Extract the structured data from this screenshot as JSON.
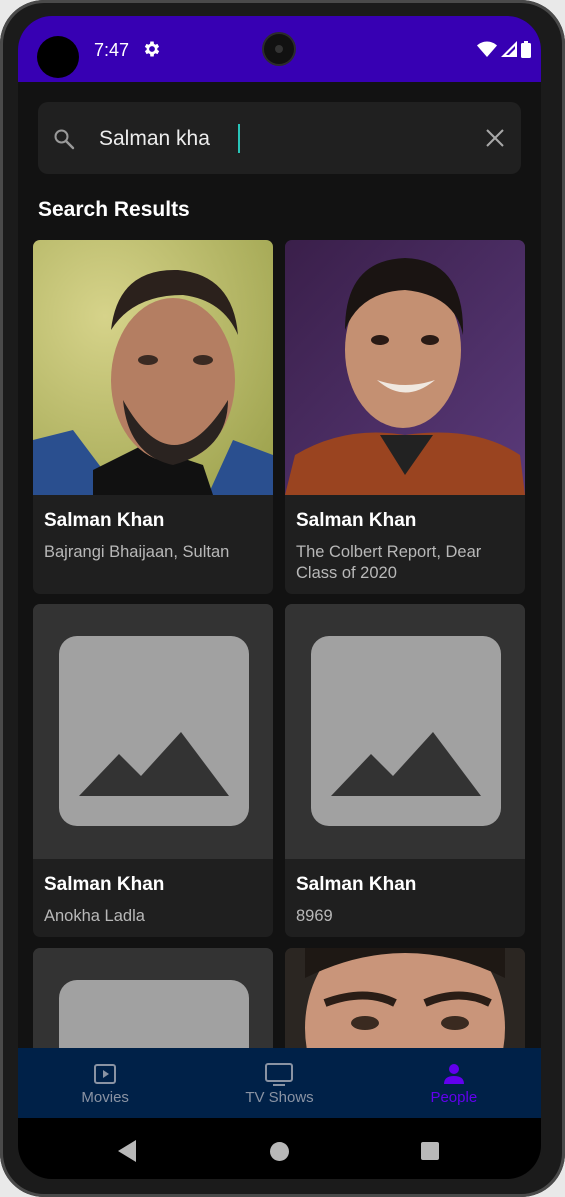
{
  "status_bar": {
    "time": "7:47",
    "background_color": "#3700b3",
    "icons": [
      "gear-icon",
      "wifi-icon",
      "signal-icon",
      "battery-icon"
    ]
  },
  "search": {
    "value": "Salman kha",
    "clear_icon": "close-icon",
    "search_icon": "search-icon"
  },
  "section_title": "Search Results",
  "results": [
    {
      "name": "Salman Khan",
      "known_for": "Bajrangi Bhaijaan, Sultan",
      "image": "photo"
    },
    {
      "name": "Salman Khan",
      "known_for": "The Colbert Report, Dear Class of 2020",
      "image": "photo"
    },
    {
      "name": "Salman Khan",
      "known_for": "Anokha Ladla",
      "image": "placeholder"
    },
    {
      "name": "Salman Khan",
      "known_for": "8969",
      "image": "placeholder"
    },
    {
      "name": "",
      "known_for": "",
      "image": "placeholder"
    },
    {
      "name": "",
      "known_for": "",
      "image": "photo"
    }
  ],
  "bottom_nav": {
    "items": [
      {
        "label": "Movies",
        "icon": "movie-icon"
      },
      {
        "label": "TV Shows",
        "icon": "tv-icon"
      },
      {
        "label": "People",
        "icon": "person-icon"
      }
    ],
    "active": "People",
    "background_color": "#002148",
    "active_color": "#6200ee"
  },
  "system_nav": {
    "icons": [
      "back-icon",
      "home-icon",
      "recents-icon"
    ]
  }
}
